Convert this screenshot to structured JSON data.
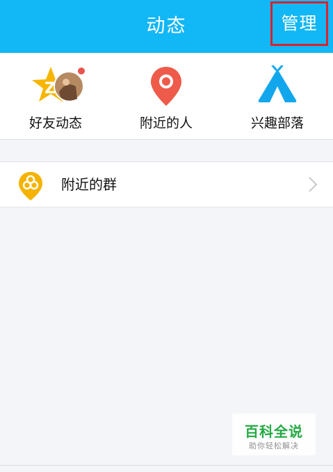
{
  "header": {
    "title": "动态",
    "manage_label": "管理"
  },
  "top_grid": {
    "items": [
      {
        "label": "好友动态",
        "icon": "qzone-star-icon",
        "has_red_dot": true
      },
      {
        "label": "附近的人",
        "icon": "location-pin-icon"
      },
      {
        "label": "兴趣部落",
        "icon": "tent-icon"
      }
    ]
  },
  "list": {
    "items": [
      {
        "label": "附近的群",
        "icon": "group-pin-icon"
      }
    ]
  },
  "watermark": {
    "title": "百科全说",
    "subtitle": "助你轻松解决"
  },
  "colors": {
    "header_bg": "#12b7f5",
    "highlight_border": "#d9232d",
    "pin_red": "#ee5b4a",
    "tent_blue": "#12a7ec",
    "star_yellow": "#f7b500",
    "group_yellow": "#f5b300",
    "watermark_green": "#19a53a"
  }
}
